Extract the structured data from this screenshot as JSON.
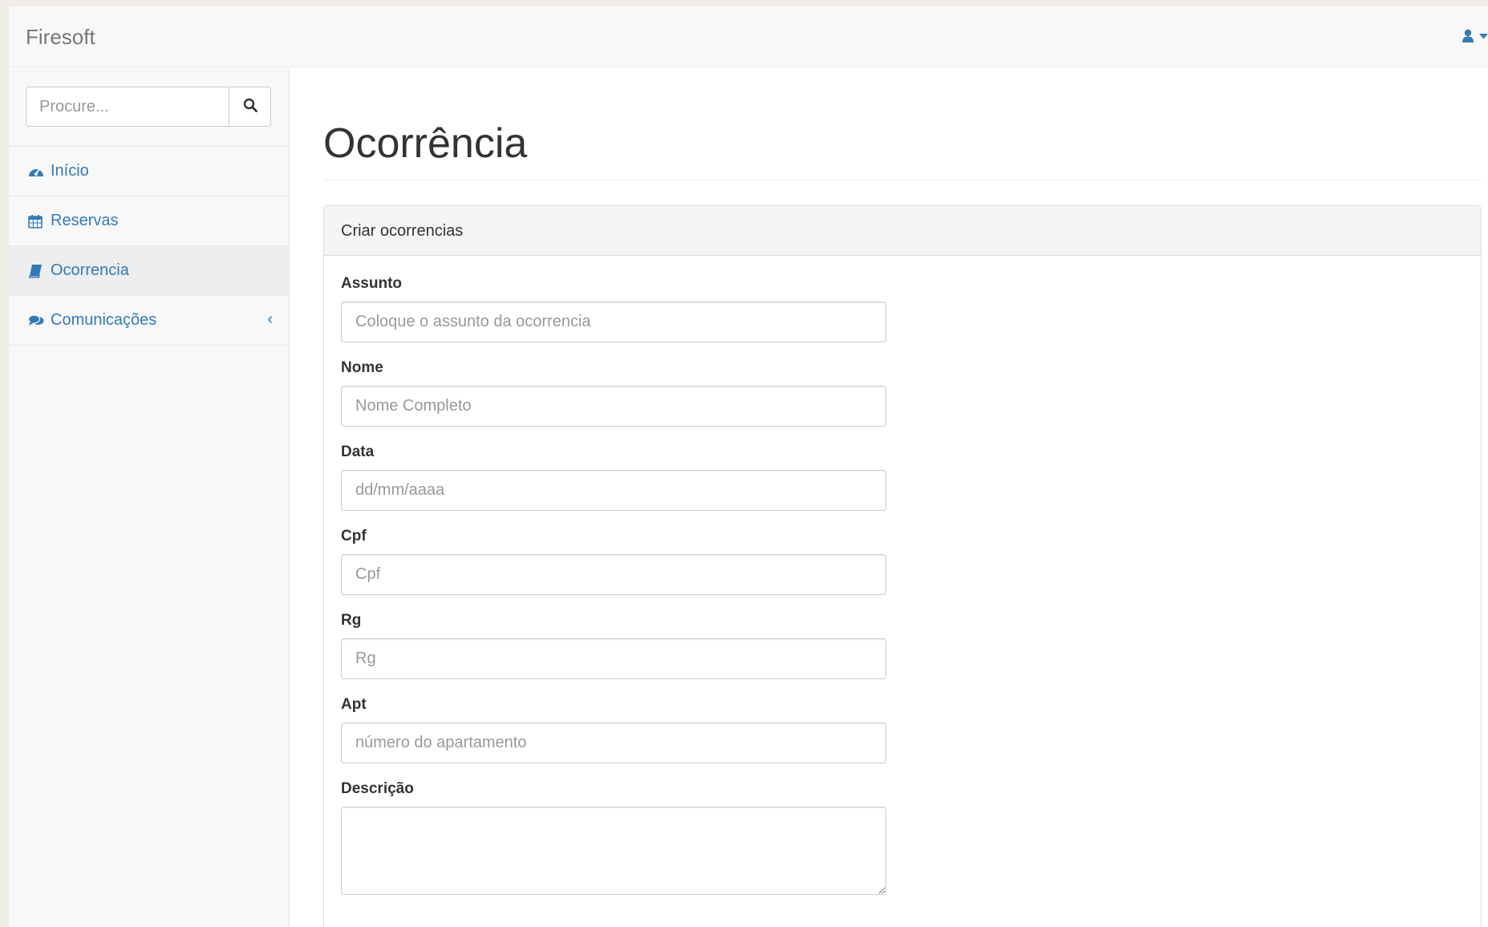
{
  "navbar": {
    "brand": "Firesoft",
    "user_icon": "user-icon",
    "caret_icon": "caret-down-icon"
  },
  "sidebar": {
    "search": {
      "placeholder": "Procure...",
      "value": "",
      "icon": "search-icon"
    },
    "items": [
      {
        "label": "Início",
        "icon": "dashboard-icon",
        "active": false
      },
      {
        "label": "Reservas",
        "icon": "calendar-icon",
        "active": false
      },
      {
        "label": "Ocorrencia",
        "icon": "book-icon",
        "active": true
      },
      {
        "label": "Comunicações",
        "icon": "comments-icon",
        "active": false,
        "chevron": "‹"
      }
    ]
  },
  "main": {
    "title": "Ocorrência",
    "panel": {
      "heading": "Criar ocorrencias",
      "fields": [
        {
          "label": "Assunto",
          "placeholder": "Coloque o assunto da ocorrencia",
          "value": ""
        },
        {
          "label": "Nome",
          "placeholder": "Nome Completo",
          "value": ""
        },
        {
          "label": "Data",
          "placeholder": "dd/mm/aaaa",
          "value": ""
        },
        {
          "label": "Cpf",
          "placeholder": "Cpf",
          "value": ""
        },
        {
          "label": "Rg",
          "placeholder": "Rg",
          "value": ""
        },
        {
          "label": "Apt",
          "placeholder": "número do apartamento",
          "value": ""
        },
        {
          "label": "Descrição",
          "placeholder": "",
          "value": ""
        }
      ]
    }
  },
  "colors": {
    "link": "#337ab7",
    "brand_text": "#777777",
    "sidebar_bg": "#f8f8f8",
    "active_bg": "#eeeeee",
    "border": "#dddddd"
  }
}
